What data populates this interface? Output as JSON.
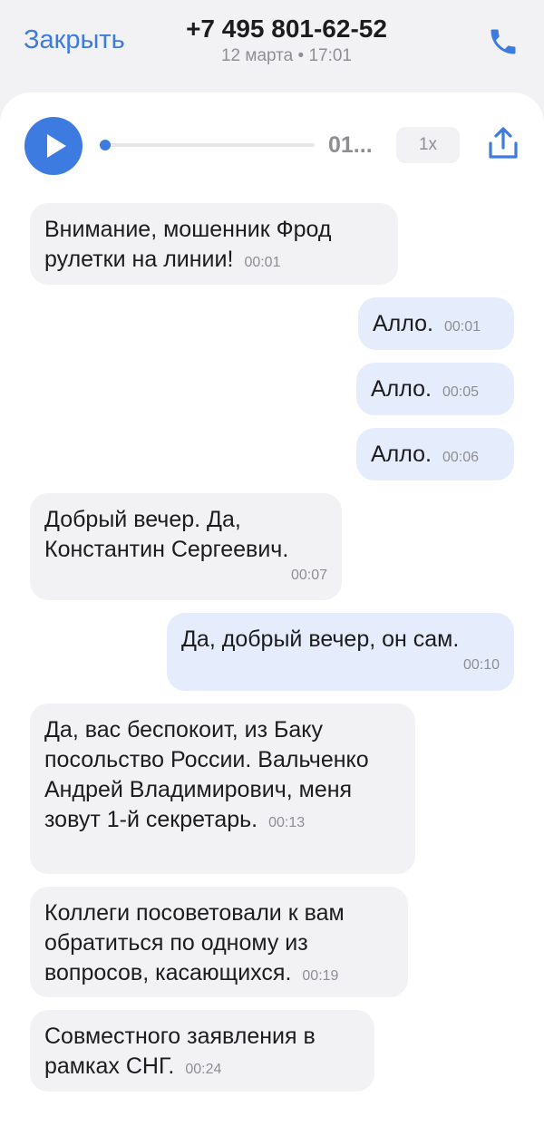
{
  "header": {
    "close_label": "Закрыть",
    "title": "+7 495 801-62-52",
    "subtitle": "12 марта • 17:01"
  },
  "player": {
    "time_label": "01...",
    "speed_label": "1x",
    "progress": 0.0
  },
  "colors": {
    "accent": "#3d7be0",
    "incoming_bubble": "#f2f2f5",
    "outgoing_bubble": "#e5ecfc",
    "muted_text": "#8e8e93"
  },
  "icons": {
    "play": "play-icon",
    "phone": "phone-icon",
    "share": "share-icon"
  },
  "messages": [
    {
      "text": "Внимание, мошенник Фрод рулетки на линии!",
      "time": "00:01",
      "direction": "incoming"
    },
    {
      "text": "Алло.",
      "time": "00:01",
      "direction": "outgoing"
    },
    {
      "text": "Алло.",
      "time": "00:05",
      "direction": "outgoing"
    },
    {
      "text": "Алло.",
      "time": "00:06",
      "direction": "outgoing"
    },
    {
      "text": "Добрый вечер. Да, Константин Сергеевич.",
      "time": "00:07",
      "direction": "incoming"
    },
    {
      "text": "Да, добрый вечер, он сам.",
      "time": "00:10",
      "direction": "outgoing"
    },
    {
      "text": "Да, вас беспокоит, из Баку посольство России. Вальченко Андрей Владимирович, меня зовут 1-й секретарь.",
      "time": "00:13",
      "direction": "incoming"
    },
    {
      "text": "Коллеги посоветовали к вам обратиться по одному из вопросов, касающихся.",
      "time": "00:19",
      "direction": "incoming"
    },
    {
      "text": "Совместного заявления в рамках СНГ.",
      "time": "00:24",
      "direction": "incoming"
    }
  ]
}
